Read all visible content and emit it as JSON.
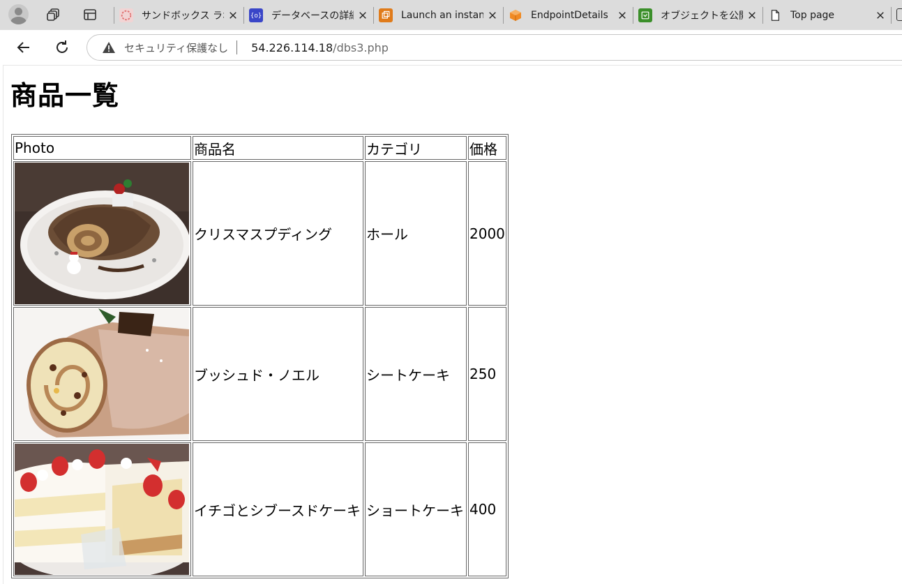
{
  "browser": {
    "tabs": [
      {
        "title": "サンドボックス ラボ",
        "favicon": "sandbox-lab-icon",
        "color": "#e8a0a0"
      },
      {
        "title": "データベースの詳細",
        "favicon": "database-icon",
        "color": "#3a46c8"
      },
      {
        "title": "Launch an instan",
        "favicon": "aws-ec2-icon",
        "color": "#e07b1a"
      },
      {
        "title": "EndpointDetails",
        "favicon": "aws-box-icon",
        "color": "#f08a24"
      },
      {
        "title": "オブジェクトを公開",
        "favicon": "aws-s3-icon",
        "color": "#3b8f2a"
      },
      {
        "title": "Top page",
        "favicon": "document-icon",
        "color": "#ffffff"
      }
    ],
    "address": {
      "security_label": "セキュリティ保護なし",
      "host": "54.226.114.18",
      "path": "/dbs3.php"
    }
  },
  "page": {
    "title": "商品一覧",
    "table": {
      "headers": [
        "Photo",
        "商品名",
        "カテゴリ",
        "価格"
      ],
      "rows": [
        {
          "photo": "christmas-log-cake-photo",
          "name": "クリスマスプディング",
          "category": "ホール",
          "price": "2000"
        },
        {
          "photo": "buche-de-noel-photo",
          "name": "ブッシュド・ノエル",
          "category": "シートケーキ",
          "price": "250"
        },
        {
          "photo": "strawberry-shortcake-photo",
          "name": "イチゴとシブースドケーキ",
          "category": "ショートケーキ",
          "price": "400"
        }
      ]
    }
  }
}
